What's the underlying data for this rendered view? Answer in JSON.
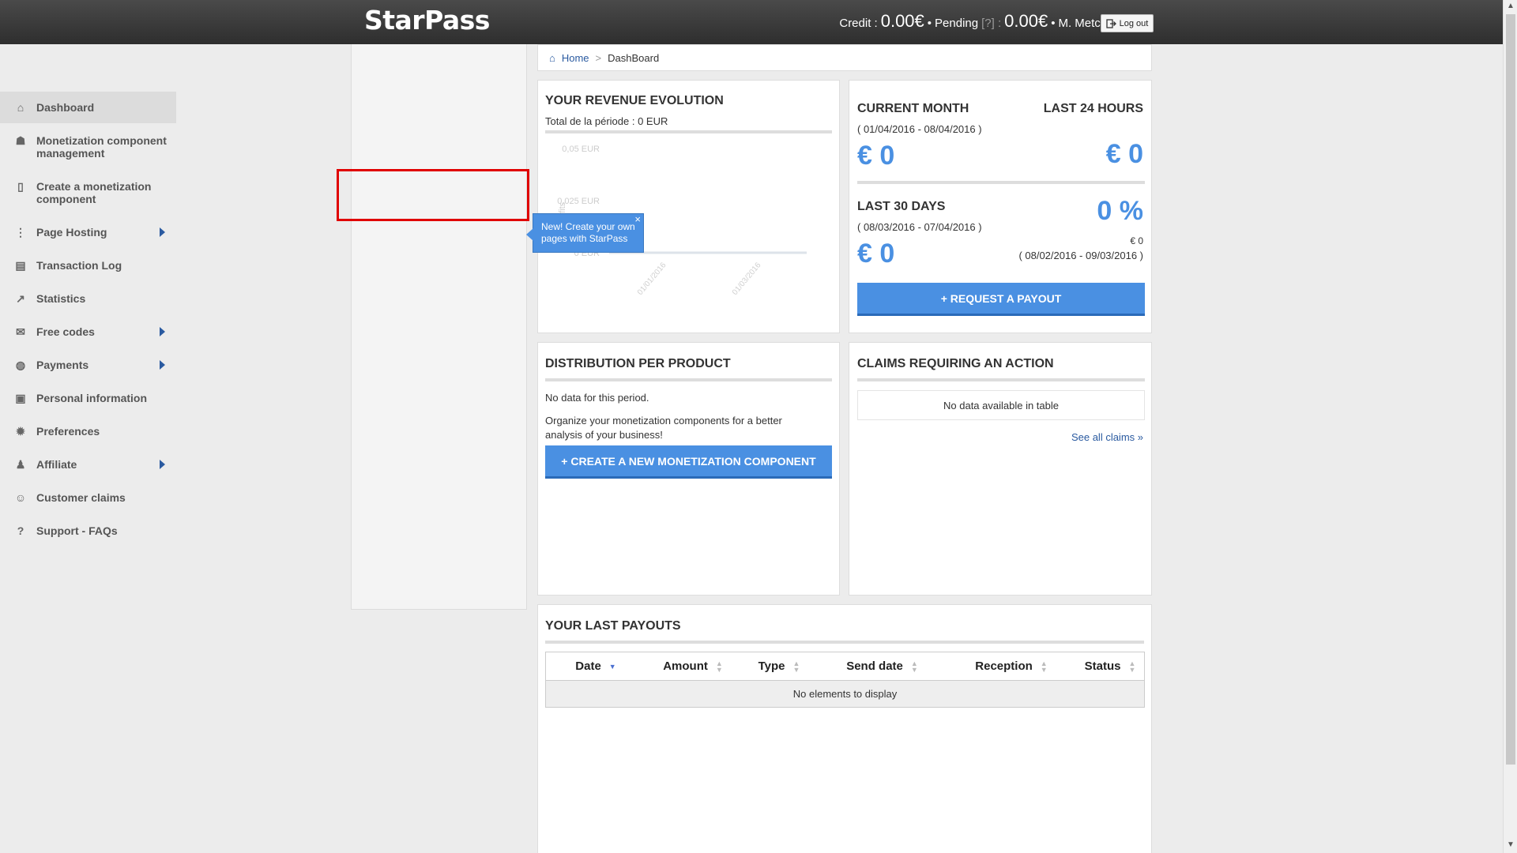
{
  "header": {
    "logo": "StarPass",
    "credit_label": "Credit :",
    "credit_value": "0.00€",
    "dot1": "•",
    "pending_label": "Pending",
    "pending_help": "[?] :",
    "pending_value": "0.00€",
    "dot2": "•",
    "user": "M. Metcalfe Craig",
    "logout": "Log out"
  },
  "sidebar": {
    "items": [
      {
        "label": "Dashboard",
        "icon": "home-icon"
      },
      {
        "label": "Monetization component management",
        "icon": "hat-icon"
      },
      {
        "label": "Create a monetization component",
        "icon": "document-icon"
      },
      {
        "label": "Page Hosting",
        "icon": "sitemap-icon"
      },
      {
        "label": "Transaction Log",
        "icon": "log-icon"
      },
      {
        "label": "Statistics",
        "icon": "chart-icon"
      },
      {
        "label": "Free codes",
        "icon": "gift-icon"
      },
      {
        "label": "Payments",
        "icon": "money-bag-icon"
      },
      {
        "label": "Personal information",
        "icon": "id-card-icon"
      },
      {
        "label": "Preferences",
        "icon": "gear-icon"
      },
      {
        "label": "Affiliate",
        "icon": "user-icon"
      },
      {
        "label": "Customer claims",
        "icon": "users-icon"
      },
      {
        "label": "Support - FAQs",
        "icon": "question-icon"
      }
    ],
    "tooltip": "New! Create your own pages with StarPass",
    "tooltip_close": "×"
  },
  "breadcrumb": {
    "home": "Home",
    "sep": ">",
    "current": "DashBoard"
  },
  "revenue": {
    "title": "YOUR REVENUE EVOLUTION",
    "subtitle": "Total de la période : 0 EUR"
  },
  "chart_data": {
    "type": "line",
    "title": "",
    "ylabel": "Profits",
    "xlabel": "",
    "y_ticks": [
      "0,05 EUR",
      "0,025 EUR",
      "0 EUR"
    ],
    "x_ticks": [
      "01/01/2016",
      "01/03/2016"
    ],
    "ylim": [
      0,
      0.05
    ],
    "series": [
      {
        "values": [
          0,
          0
        ]
      }
    ]
  },
  "summary": {
    "current_month": "CURRENT MONTH",
    "current_range": "( 01/04/2016 - 08/04/2016 )",
    "current_value": "€ 0",
    "last24": "LAST 24 HOURS",
    "last24_value": "€ 0",
    "last30": "LAST 30 DAYS",
    "last30_range": "( 08/03/2016 - 07/04/2016 )",
    "last30_value": "€ 0",
    "percent": "0 %",
    "prev_value": "€ 0",
    "prev_range": "( 08/02/2016 - 09/03/2016 )",
    "payout_button": "+ REQUEST A PAYOUT"
  },
  "distribution": {
    "title": "DISTRIBUTION PER PRODUCT",
    "no_data": "No data for this period.",
    "text": "Organize your monetization components for a better analysis of your business!",
    "button": "+ CREATE A NEW MONETIZATION COMPONENT"
  },
  "claims": {
    "title": "CLAIMS REQUIRING AN ACTION",
    "no_data": "No data available in table",
    "see_all": "See all claims »"
  },
  "payouts": {
    "title": "YOUR LAST PAYOUTS",
    "columns": [
      "Date",
      "Amount",
      "Type",
      "Send date",
      "Reception",
      "Status"
    ],
    "empty": "No elements to display"
  }
}
